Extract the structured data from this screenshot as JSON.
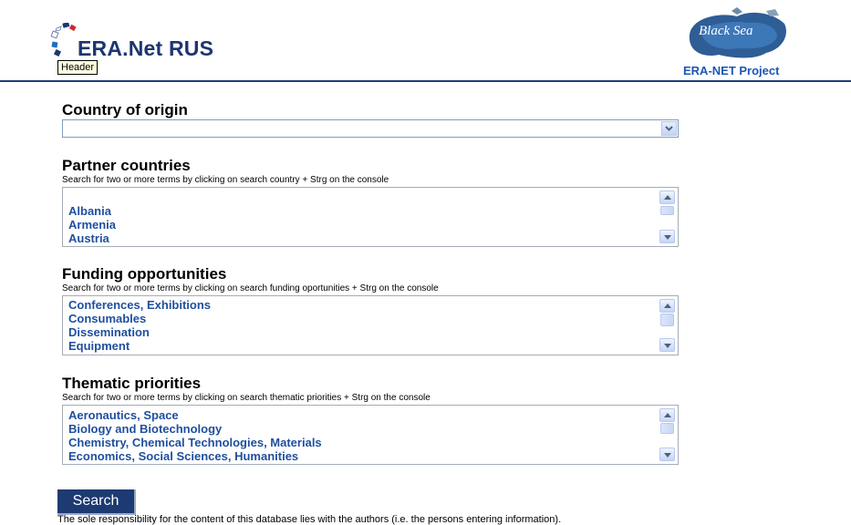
{
  "header": {
    "logo_title": "ERA.Net RUS",
    "tooltip": "Header",
    "partner_logo_text": "Black Sea",
    "partner_logo_caption": "ERA-NET Project"
  },
  "country_of_origin": {
    "title": "Country of origin",
    "selected_value": ""
  },
  "partner_countries": {
    "title": "Partner countries",
    "hint": "Search for two or more terms by clicking on search country + Strg on the console",
    "items": [
      "",
      "Albania",
      "Armenia",
      "Austria"
    ]
  },
  "funding_opportunities": {
    "title": "Funding opportunities",
    "hint": "Search for two or more terms by clicking on search funding oportunities + Strg on the console",
    "items": [
      "Conferences, Exhibitions",
      "Consumables",
      "Dissemination",
      "Equipment"
    ]
  },
  "thematic_priorities": {
    "title": "Thematic priorities",
    "hint": "Search for two or more terms by clicking on search thematic priorities + Strg on the console",
    "items": [
      "Aeronautics, Space",
      "Biology and Biotechnology",
      "Chemistry, Chemical Technologies, Materials",
      "Economics, Social Sciences, Humanities"
    ]
  },
  "search_button": "Search",
  "disclaimer": "The sole responsibility for the content of this database lies with the authors (i.e. the persons entering information).",
  "colors": {
    "brand_navy": "#1d3570",
    "link_blue": "#1f4f9e",
    "button_bg": "#1d3a73"
  },
  "icons": {
    "logo": "era-net-rus-logo-icon",
    "partner_logo": "black-sea-map-icon",
    "dropdown": "chevron-down-icon"
  }
}
